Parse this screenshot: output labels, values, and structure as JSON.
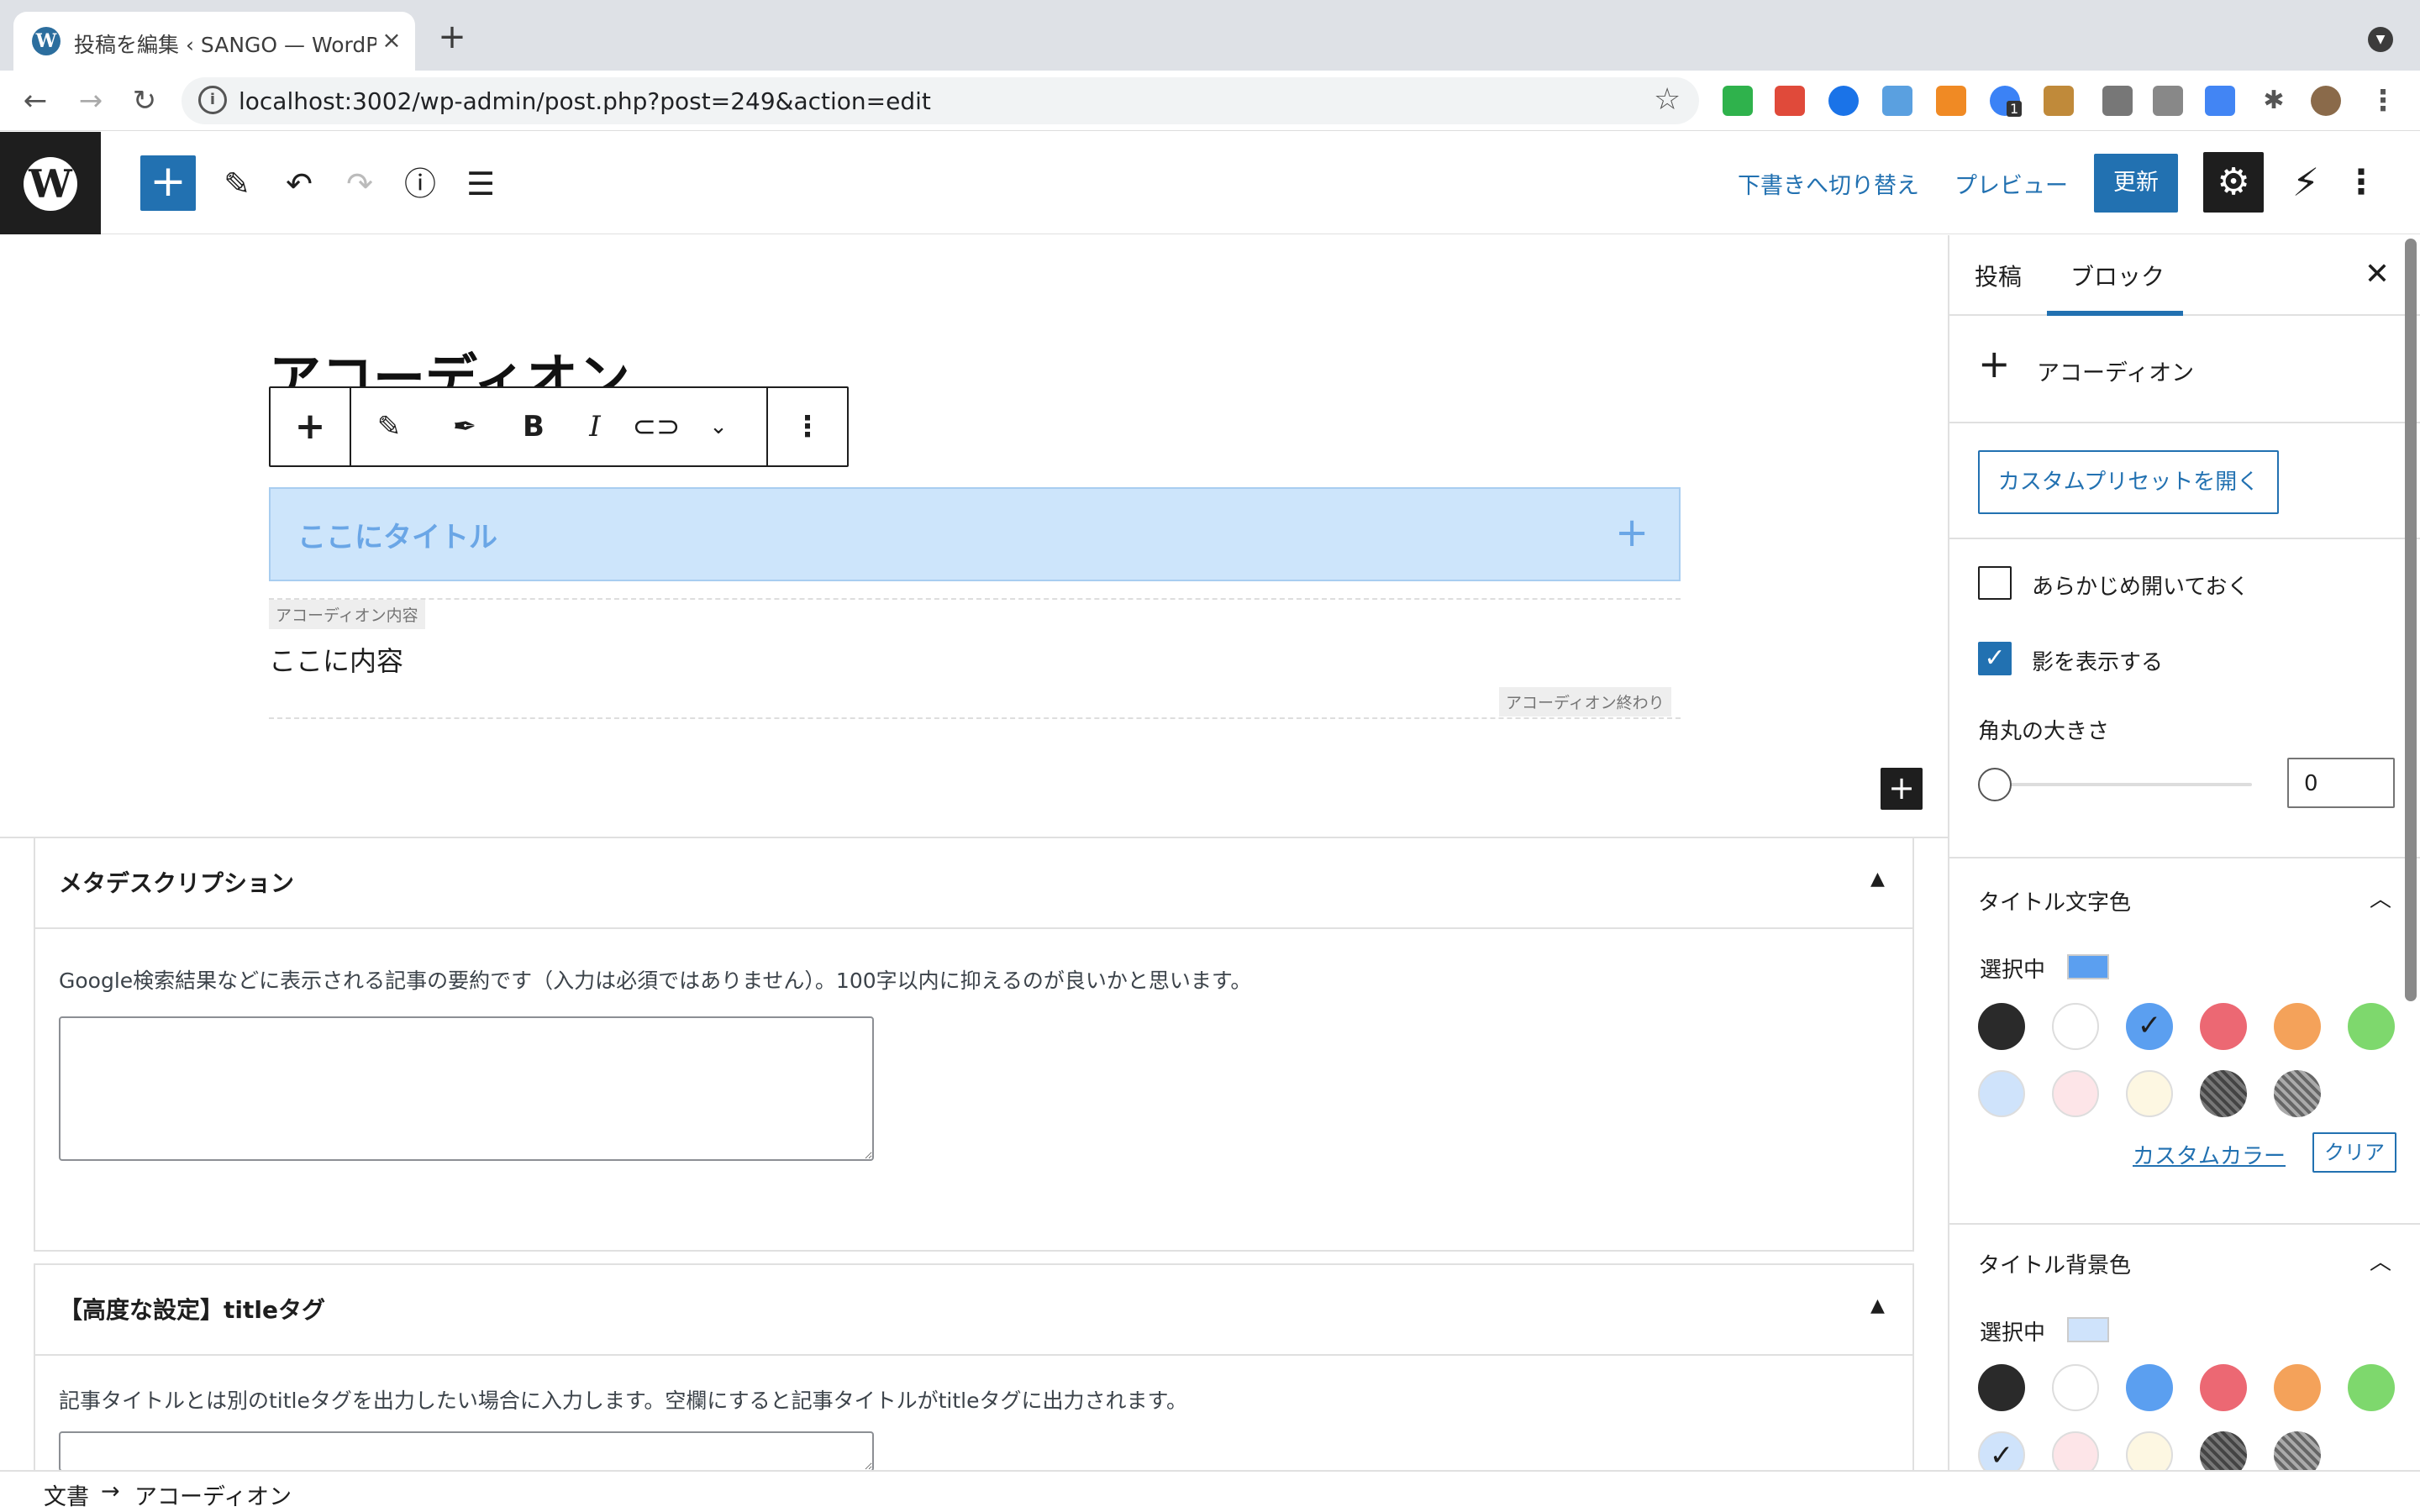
{
  "browser": {
    "tab_title": "投稿を編集 ‹ SANGO — WordPre",
    "tab_close": "×",
    "new_tab": "+",
    "url": "localhost:3002/wp-admin/post.php?post=249&action=edit",
    "extension_badge": "1",
    "icons": [
      "back-arrow-icon",
      "forward-arrow-icon",
      "reload-icon",
      "info-icon",
      "star-icon",
      "puzzle-icon",
      "more-icon"
    ]
  },
  "wp_toolbar": {
    "switch_to_draft": "下書きへ切り替え",
    "preview": "プレビュー",
    "update": "更新"
  },
  "editor": {
    "post_title": "アコーディオン",
    "accordion_title": "ここにタイトル",
    "content_label": "アコーディオン内容",
    "content_text": "ここに内容",
    "end_label": "アコーディオン終わり"
  },
  "metaboxes": {
    "meta_description": {
      "title": "メタデスクリプション",
      "description": "Google検索結果などに表示される記事の要約です（入力は必須ではありません）。100字以内に抑えるのが良いかと思います。",
      "value": ""
    },
    "title_tag": {
      "title": "【高度な設定】titleタグ",
      "description": "記事タイトルとは別のtitleタグを出力したい場合に入力します。空欄にすると記事タイトルがtitleタグに出力されます。",
      "value": ""
    }
  },
  "sidebar": {
    "tabs": [
      "投稿",
      "ブロック"
    ],
    "active_tab": "ブロック",
    "block_name": "アコーディオン",
    "preset_button": "カスタムプリセットを開く",
    "open_by_default": {
      "label": "あらかじめ開いておく",
      "checked": false
    },
    "show_shadow": {
      "label": "影を表示する",
      "checked": true
    },
    "radius_label": "角丸の大きさ",
    "radius_value": "0",
    "title_text_color": {
      "heading": "タイトル文字色",
      "selected_label": "選択中",
      "selected_color": "#5b9ff0",
      "custom_color": "カスタムカラー",
      "clear": "クリア"
    },
    "title_bg_color": {
      "heading": "タイトル背景色",
      "selected_label": "選択中",
      "selected_color": "#cfe3fb"
    },
    "palette": [
      "#2a2a2a",
      "#ffffff",
      "#5b9ff0",
      "#ec6873",
      "#f4a25a",
      "#7ed86d",
      "#cfe3fb",
      "#fde5e8",
      "#fdf7e2",
      "hatch-dark",
      "hatch-gray"
    ]
  },
  "footer": {
    "crumb_root": "文書",
    "crumb_arrow": "→",
    "crumb_current": "アコーディオン"
  }
}
